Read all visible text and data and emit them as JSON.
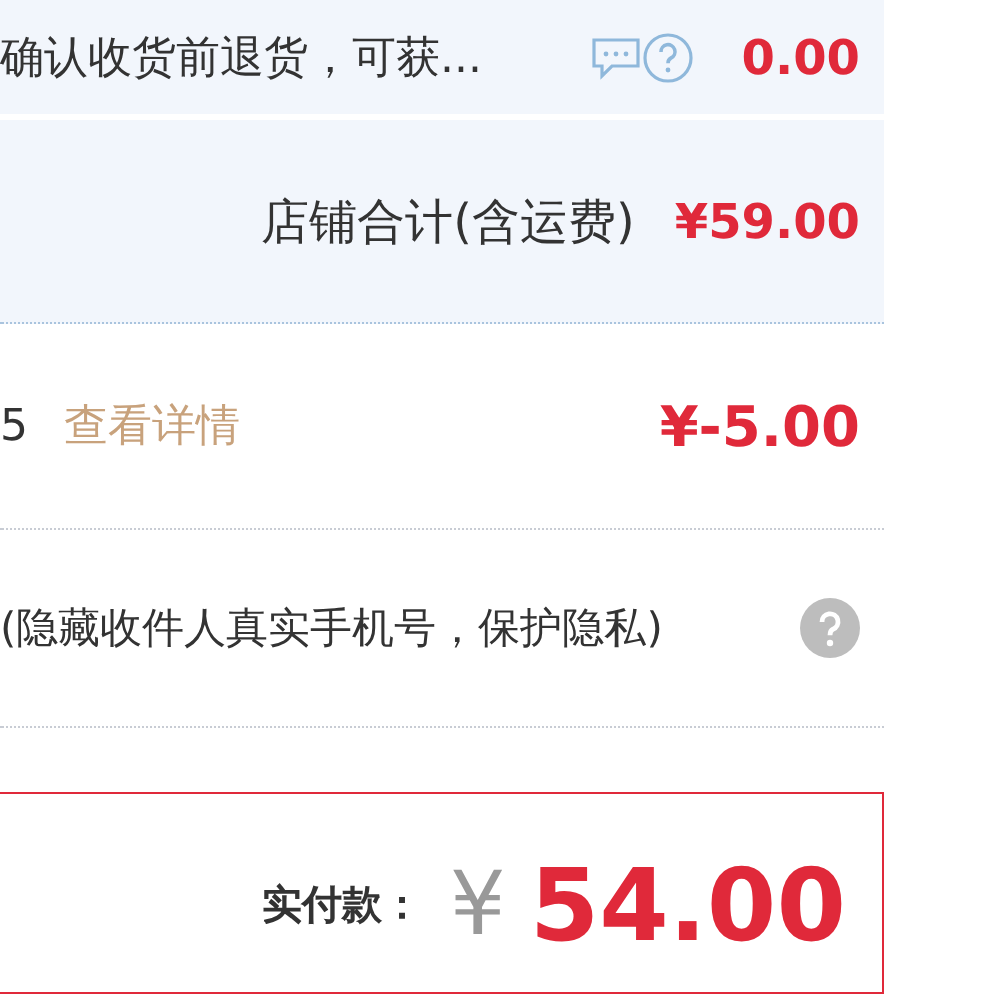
{
  "refund_row": {
    "text": "确认收货前退货，可获...",
    "amount": "0.00"
  },
  "shop_total": {
    "label": "店铺合计(含运费)",
    "amount": "¥59.00"
  },
  "discount_row": {
    "prefix": "5",
    "link": "查看详情",
    "amount": "¥-5.00"
  },
  "privacy_row": {
    "text": "(隐藏收件人真实手机号，保护隐私)"
  },
  "pay_box": {
    "label": "实付款：",
    "currency": "¥",
    "amount": "54.00"
  }
}
